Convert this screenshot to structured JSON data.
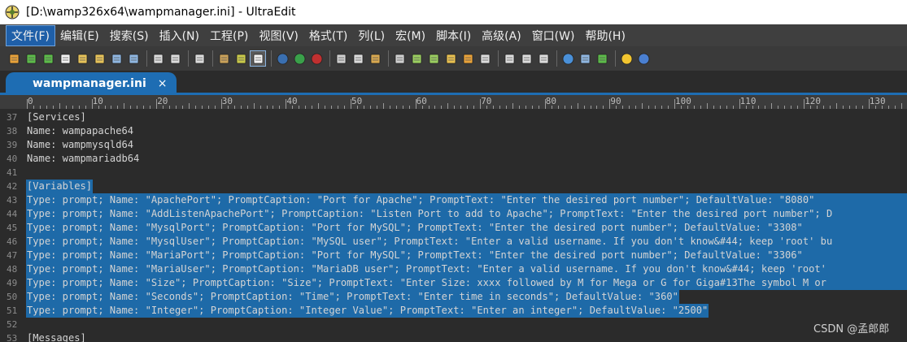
{
  "window": {
    "title": "[D:\\wamp326x64\\wampmanager.ini] - UltraEdit"
  },
  "menu": [
    {
      "label": "文件(F)",
      "active": true
    },
    {
      "label": "编辑(E)"
    },
    {
      "label": "搜索(S)"
    },
    {
      "label": "插入(N)"
    },
    {
      "label": "工程(P)"
    },
    {
      "label": "视图(V)"
    },
    {
      "label": "格式(T)"
    },
    {
      "label": "列(L)"
    },
    {
      "label": "宏(M)"
    },
    {
      "label": "脚本(I)"
    },
    {
      "label": "高级(A)"
    },
    {
      "label": "窗口(W)"
    },
    {
      "label": "帮助(H)"
    }
  ],
  "toolbar_icons": [
    "new-project-icon",
    "back-arrow-icon",
    "forward-arrow-icon",
    "new-file-icon",
    "open-folder-icon",
    "open-file-icon",
    "save-icon",
    "save-all-icon",
    "print-icon",
    "print-preview-icon",
    "properties-icon",
    "spellcheck-icon",
    "column-mode-icon",
    "word-wrap-icon",
    "tool-c-icon",
    "tool-plus-icon",
    "tool-s-icon",
    "cut-icon",
    "copy-icon",
    "paste-icon",
    "find-icon",
    "find-next-icon",
    "replace-icon",
    "find-files-icon",
    "bookmark-icon",
    "list-icon",
    "window-tile-icon",
    "window-cascade-icon",
    "window-stack-icon",
    "web-icon",
    "screenshot-icon",
    "refresh-icon",
    "tip-icon",
    "help-icon"
  ],
  "tab": {
    "label": "wampmanager.ini",
    "close": "×"
  },
  "ruler": {
    "labels": [
      "0",
      "10",
      "20",
      "30",
      "40",
      "50",
      "60",
      "70",
      "80",
      "90",
      "100",
      "110",
      "120",
      "130"
    ]
  },
  "editor": {
    "lines": [
      {
        "num": "37",
        "text": "[Services]",
        "selected": false
      },
      {
        "num": "38",
        "text": "Name: wampapache64",
        "selected": false
      },
      {
        "num": "39",
        "text": "Name: wampmysqld64",
        "selected": false
      },
      {
        "num": "40",
        "text": "Name: wampmariadb64",
        "selected": false
      },
      {
        "num": "41",
        "text": "",
        "selected": false
      },
      {
        "num": "42",
        "text": "[Variables]",
        "selected": true
      },
      {
        "num": "43",
        "text": "Type: prompt; Name: \"ApachePort\"; PromptCaption: \"Port for Apache\"; PromptText: \"Enter the desired port number\"; DefaultValue: \"8080\"",
        "selected": true
      },
      {
        "num": "44",
        "text": "Type: prompt; Name: \"AddListenApachePort\"; PromptCaption: \"Listen Port to add to Apache\"; PromptText: \"Enter the desired port number\"; D",
        "selected": true
      },
      {
        "num": "45",
        "text": "Type: prompt; Name: \"MysqlPort\"; PromptCaption: \"Port for MySQL\"; PromptText: \"Enter the desired port number\"; DefaultValue: \"3308\"",
        "selected": true
      },
      {
        "num": "46",
        "text": "Type: prompt; Name: \"MysqlUser\"; PromptCaption: \"MySQL user\"; PromptText: \"Enter a valid username. If you don't know&#44; keep 'root' bu",
        "selected": true
      },
      {
        "num": "47",
        "text": "Type: prompt; Name: \"MariaPort\"; PromptCaption: \"Port for MySQL\"; PromptText: \"Enter the desired port number\"; DefaultValue: \"3306\"",
        "selected": true
      },
      {
        "num": "48",
        "text": "Type: prompt; Name: \"MariaUser\"; PromptCaption: \"MariaDB user\"; PromptText: \"Enter a valid username. If you don't know&#44; keep 'root'",
        "selected": true
      },
      {
        "num": "49",
        "text": "Type: prompt; Name: \"Size\"; PromptCaption: \"Size\"; PromptText: \"Enter Size: xxxx followed by M for Mega or G for Giga#13The symbol M or",
        "selected": true
      },
      {
        "num": "50",
        "text": "Type: prompt; Name: \"Seconds\"; PromptCaption: \"Time\"; PromptText: \"Enter time in seconds\"; DefaultValue: \"360\"",
        "selected": true
      },
      {
        "num": "51",
        "text": "Type: prompt; Name: \"Integer\"; PromptCaption: \"Integer Value\"; PromptText: \"Enter an integer\"; DefaultValue: \"2500\"",
        "selected": true
      },
      {
        "num": "52",
        "text": "",
        "selected": false
      },
      {
        "num": "53",
        "text": "[Messages]",
        "selected": false
      }
    ]
  },
  "watermark": "CSDN @孟郎郎",
  "colors": {
    "accent": "#1e6db3",
    "selection": "#1e6aa8",
    "background": "#2b2b2b",
    "text": "#d4d4d4"
  }
}
